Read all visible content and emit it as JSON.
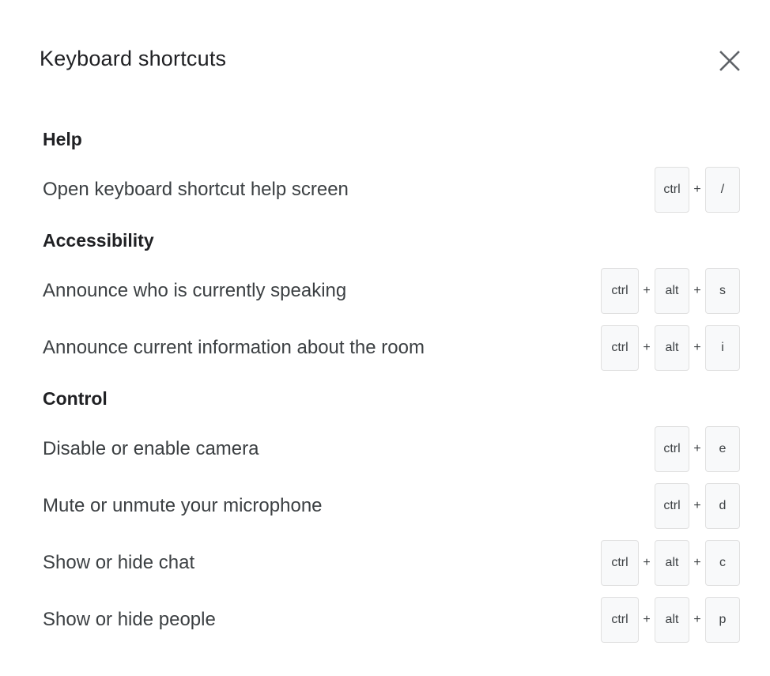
{
  "dialog": {
    "title": "Keyboard shortcuts",
    "close_icon": "close-icon"
  },
  "sections": [
    {
      "title": "Help",
      "rows": [
        {
          "label": "Open keyboard shortcut help screen",
          "keys": [
            "ctrl",
            "/"
          ]
        }
      ]
    },
    {
      "title": "Accessibility",
      "rows": [
        {
          "label": "Announce who is currently speaking",
          "keys": [
            "ctrl",
            "alt",
            "s"
          ]
        },
        {
          "label": "Announce current information about the room",
          "keys": [
            "ctrl",
            "alt",
            "i"
          ]
        }
      ]
    },
    {
      "title": "Control",
      "rows": [
        {
          "label": "Disable or enable camera",
          "keys": [
            "ctrl",
            "e"
          ]
        },
        {
          "label": "Mute or unmute your microphone",
          "keys": [
            "ctrl",
            "d"
          ]
        },
        {
          "label": "Show or hide chat",
          "keys": [
            "ctrl",
            "alt",
            "c"
          ]
        },
        {
          "label": "Show or hide people",
          "keys": [
            "ctrl",
            "alt",
            "p"
          ]
        }
      ]
    }
  ],
  "key_separator": "+"
}
